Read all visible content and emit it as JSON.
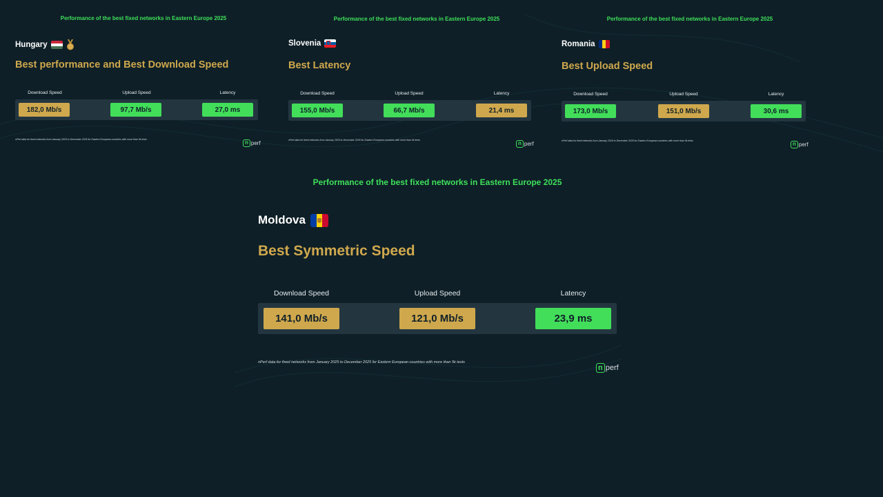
{
  "colors": {
    "background": "#0e1f27",
    "headline": "#3fe05a",
    "gold": "#cfa84d",
    "green": "#42de5a",
    "panel": "#233640"
  },
  "cards": [
    {
      "headline": "Performance of the best fixed networks in Eastern Europe 2025",
      "country": "Hungary",
      "flag_icon": "hungary-flag-icon",
      "medal_icon": "medal-icon",
      "best": "Best performance and Best Download Speed",
      "labels": [
        "Download Speed",
        "Upload Speed",
        "Latency"
      ],
      "values": [
        "182,0 Mb/s",
        "97,7 Mb/s",
        "27,0 ms"
      ],
      "footnote": "nPerf data for fixed networks from January 2025 to December 2025 for Eastern European countries with more than 5k tests",
      "logo_n": "n",
      "logo_text": "perf"
    },
    {
      "headline": "Performance of the best fixed networks in Eastern Europe 2025",
      "country": "Slovenia",
      "flag_icon": "slovenia-flag-icon",
      "best": "Best Latency",
      "labels": [
        "Download Speed",
        "Upload Speed",
        "Latency"
      ],
      "values": [
        "155,0 Mb/s",
        "66,7 Mb/s",
        "21,4 ms"
      ],
      "footnote": "nPerf data for fixed networks from January 2025 to December 2025 for Eastern European countries with more than 5k tests",
      "logo_n": "n",
      "logo_text": "perf"
    },
    {
      "headline": "Performance of the best fixed networks in Eastern Europe 2025",
      "country": "Romania",
      "flag_icon": "romania-flag-icon",
      "best": "Best Upload Speed",
      "labels": [
        "Download Speed",
        "Upload Speed",
        "Latency"
      ],
      "values": [
        "173,0 Mb/s",
        "151,0 Mb/s",
        "30,6 ms"
      ],
      "footnote": "nPerf data for fixed networks from January 2025 to December 2025 for Eastern European countries with more than 5k tests",
      "logo_n": "n",
      "logo_text": "perf"
    },
    {
      "headline": "Performance of the best fixed networks in Eastern Europe 2025",
      "country": "Moldova",
      "flag_icon": "moldova-flag-icon",
      "best": "Best Symmetric Speed",
      "labels": [
        "Download Speed",
        "Upload Speed",
        "Latency"
      ],
      "values": [
        "141,0 Mb/s",
        "121,0 Mb/s",
        "23,9 ms"
      ],
      "footnote": "nPerf data for fixed networks from January 2025 to December 2025 for Eastern European countries with more than 5k tests",
      "logo_n": "n",
      "logo_text": "perf"
    }
  ]
}
